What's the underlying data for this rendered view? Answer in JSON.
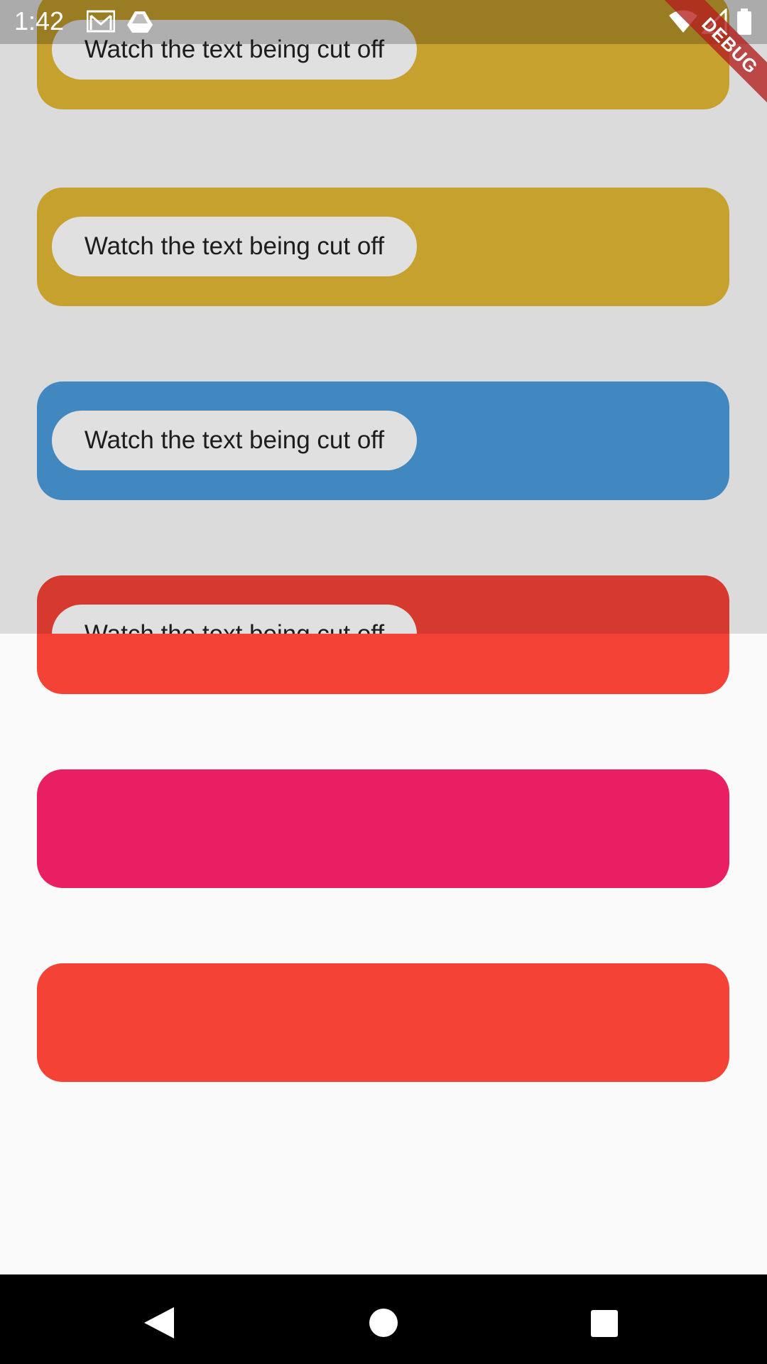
{
  "status_bar": {
    "time": "1:42",
    "icons": [
      "gmail-icon",
      "drive-icon",
      "wifi-icon",
      "signal-icon",
      "battery-icon"
    ]
  },
  "debug_banner": {
    "label": "DEBUG"
  },
  "cards": [
    {
      "color": "#e2b834",
      "pill_text": "Watch the text being cut off"
    },
    {
      "color": "#e2b834",
      "pill_text": "Watch the text being cut off"
    },
    {
      "color": "#4a9bdb",
      "pill_text": "Watch the text being cut off"
    },
    {
      "color": "#f44336",
      "pill_text": "Watch the text being cut off"
    },
    {
      "color": "#e91e63",
      "pill_text": ""
    },
    {
      "color": "#f44336",
      "pill_text": ""
    }
  ],
  "nav_bar": {
    "buttons": [
      "back-icon",
      "home-icon",
      "recents-icon"
    ]
  }
}
